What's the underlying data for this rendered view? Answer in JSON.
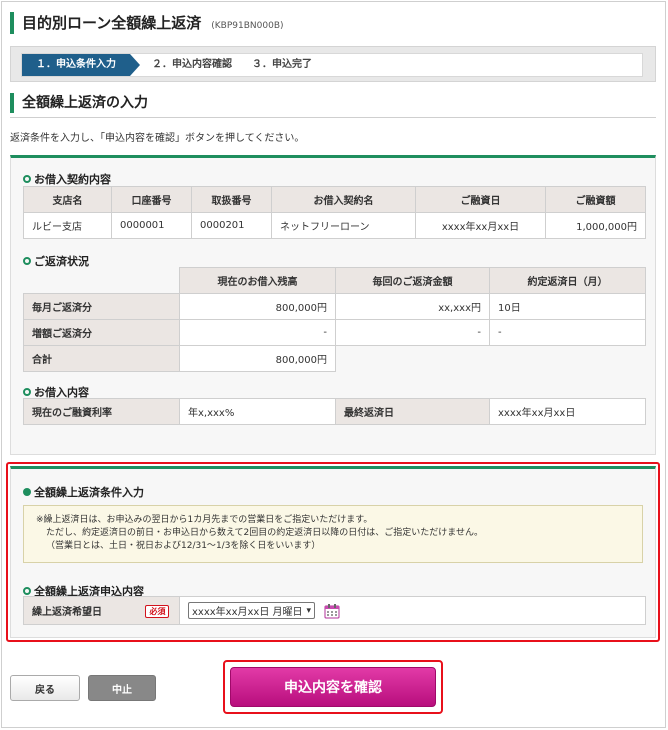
{
  "page": {
    "title": "目的別ローン全額繰上返済",
    "screen_code": "(KBP91BN000B)"
  },
  "steps": [
    "１．申込条件入力",
    "２．申込内容確認",
    "３．申込完了"
  ],
  "section_title": "全額繰上返済の入力",
  "intro": "返済条件を入力し、「申込内容を確認」ボタンを押してください。",
  "contract": {
    "title": "お借入契約内容",
    "headers": [
      "支店名",
      "口座番号",
      "取扱番号",
      "お借入契約名",
      "ご融資日",
      "ご融資額"
    ],
    "row": [
      "ルビー支店",
      "0000001",
      "0000201",
      "ネットフリーローン",
      "xxxx年xx月xx日",
      "1,000,000円"
    ]
  },
  "repayment": {
    "title": "ご返済状況",
    "headers": [
      "",
      "現在のお借入残高",
      "毎回のご返済金額",
      "約定返済日（月）"
    ],
    "rows": [
      {
        "label": "毎月ご返済分",
        "balance": "800,000円",
        "amount": "xx,xxx円",
        "day": "10日"
      },
      {
        "label": "増額ご返済分",
        "balance": "-",
        "amount": "-",
        "day": "-"
      },
      {
        "label": "合計",
        "balance": "800,000円"
      }
    ]
  },
  "loan": {
    "title": "お借入内容",
    "rate_label": "現在のご融資利率",
    "rate_value": "年x,xxx%",
    "final_label": "最終返済日",
    "final_value": "xxxx年xx月xx日"
  },
  "conditions": {
    "title": "全額繰上返済条件入力",
    "notes": [
      "※繰上返済日は、お申込みの翌日から1カ月先までの営業日をご指定いただけます。",
      "ただし、約定返済日の前日・お申込日から数えて2回目の約定返済日以降の日付は、ご指定いただけません。",
      "（営業日とは、土日・祝日および12/31～1/3を除く日をいいます）"
    ]
  },
  "application": {
    "title": "全額繰上返済申込内容",
    "field_label": "繰上返済希望日",
    "required": "必須",
    "selected_date": "xxxx年xx月xx日 月曜日",
    "calendar_icon": "calendar-icon"
  },
  "buttons": {
    "back": "戻る",
    "cancel": "中止",
    "confirm": "申込内容を確認"
  },
  "colors": {
    "accent_green": "#1e8e5e",
    "step_blue": "#1f5f8b",
    "highlight_red": "#e8101b",
    "confirm_magenta": "#c9168e"
  }
}
